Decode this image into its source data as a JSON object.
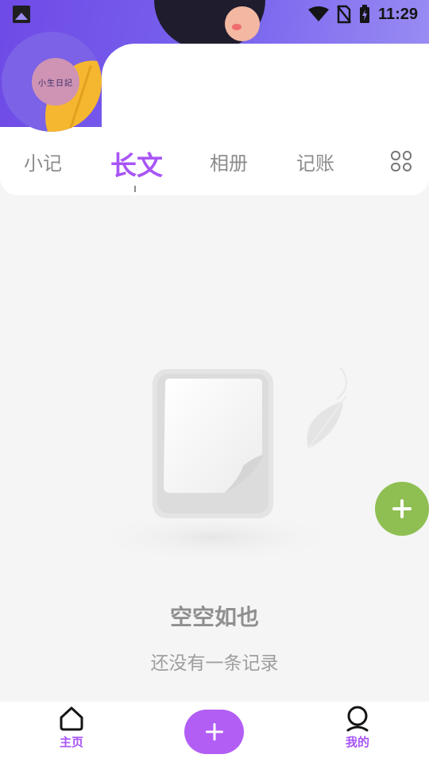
{
  "status_bar": {
    "time": "11:29",
    "icons": [
      "image-icon",
      "wifi-icon",
      "no-sim-icon",
      "battery-charging-icon"
    ]
  },
  "header": {
    "logo_text": "小生日記"
  },
  "tabs": [
    {
      "label": "小记",
      "active": false
    },
    {
      "label": "长文",
      "active": true
    },
    {
      "label": "相册",
      "active": false
    },
    {
      "label": "记账",
      "active": false
    }
  ],
  "tabs_more_icon": "grid-icon",
  "empty_state": {
    "title": "空空如也",
    "subtitle": "还没有一条记录"
  },
  "fab": {
    "icon": "plus-icon"
  },
  "bottom_nav": {
    "home_label": "主页",
    "add_icon": "plus-icon",
    "mine_label": "我的"
  },
  "colors": {
    "accent": "#a855f7",
    "fab": "#8fbf52",
    "banner": "#7b66ee"
  }
}
